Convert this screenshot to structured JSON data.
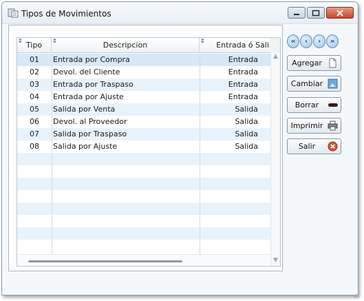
{
  "window": {
    "title": "Tipos de Movimientos"
  },
  "grid": {
    "columns": [
      "Tipo",
      "Descripcion",
      "Entrada ó Sali"
    ],
    "rows": [
      {
        "tipo": "01",
        "descripcion": "Entrada por Compra",
        "entrada": "Entrada"
      },
      {
        "tipo": "02",
        "descripcion": "Devol. del Cliente",
        "entrada": "Entrada"
      },
      {
        "tipo": "03",
        "descripcion": "Entrada por Traspaso",
        "entrada": "Entrada"
      },
      {
        "tipo": "04",
        "descripcion": "Entrada por Ajuste",
        "entrada": "Entrada"
      },
      {
        "tipo": "05",
        "descripcion": "Salida por Venta",
        "entrada": "Salida"
      },
      {
        "tipo": "06",
        "descripcion": "Devol. al Proveedor",
        "entrada": "Salida"
      },
      {
        "tipo": "07",
        "descripcion": "Salida por Traspaso",
        "entrada": "Salida"
      },
      {
        "tipo": "08",
        "descripcion": "Salida por Ajuste",
        "entrada": "Salida"
      }
    ],
    "selected_row": 0
  },
  "buttons": {
    "agregar": "Agregar",
    "cambiar": "Cambiar",
    "borrar": "Borrar",
    "imprimir": "Imprimir",
    "salir": "Salir"
  },
  "icons": {
    "nav": [
      "first-record-icon",
      "previous-record-icon",
      "next-record-icon",
      "last-record-icon"
    ],
    "agregar": "new-document-icon",
    "cambiar": "edit-image-icon",
    "borrar": "minus-icon",
    "imprimir": "printer-icon",
    "salir": "close-circle-icon"
  },
  "colors": {
    "row_alt": "#e8f2fb",
    "row_selected": "#d7e8f8",
    "close_button": "#c8452a",
    "nav_button": "#9cc4ea"
  }
}
